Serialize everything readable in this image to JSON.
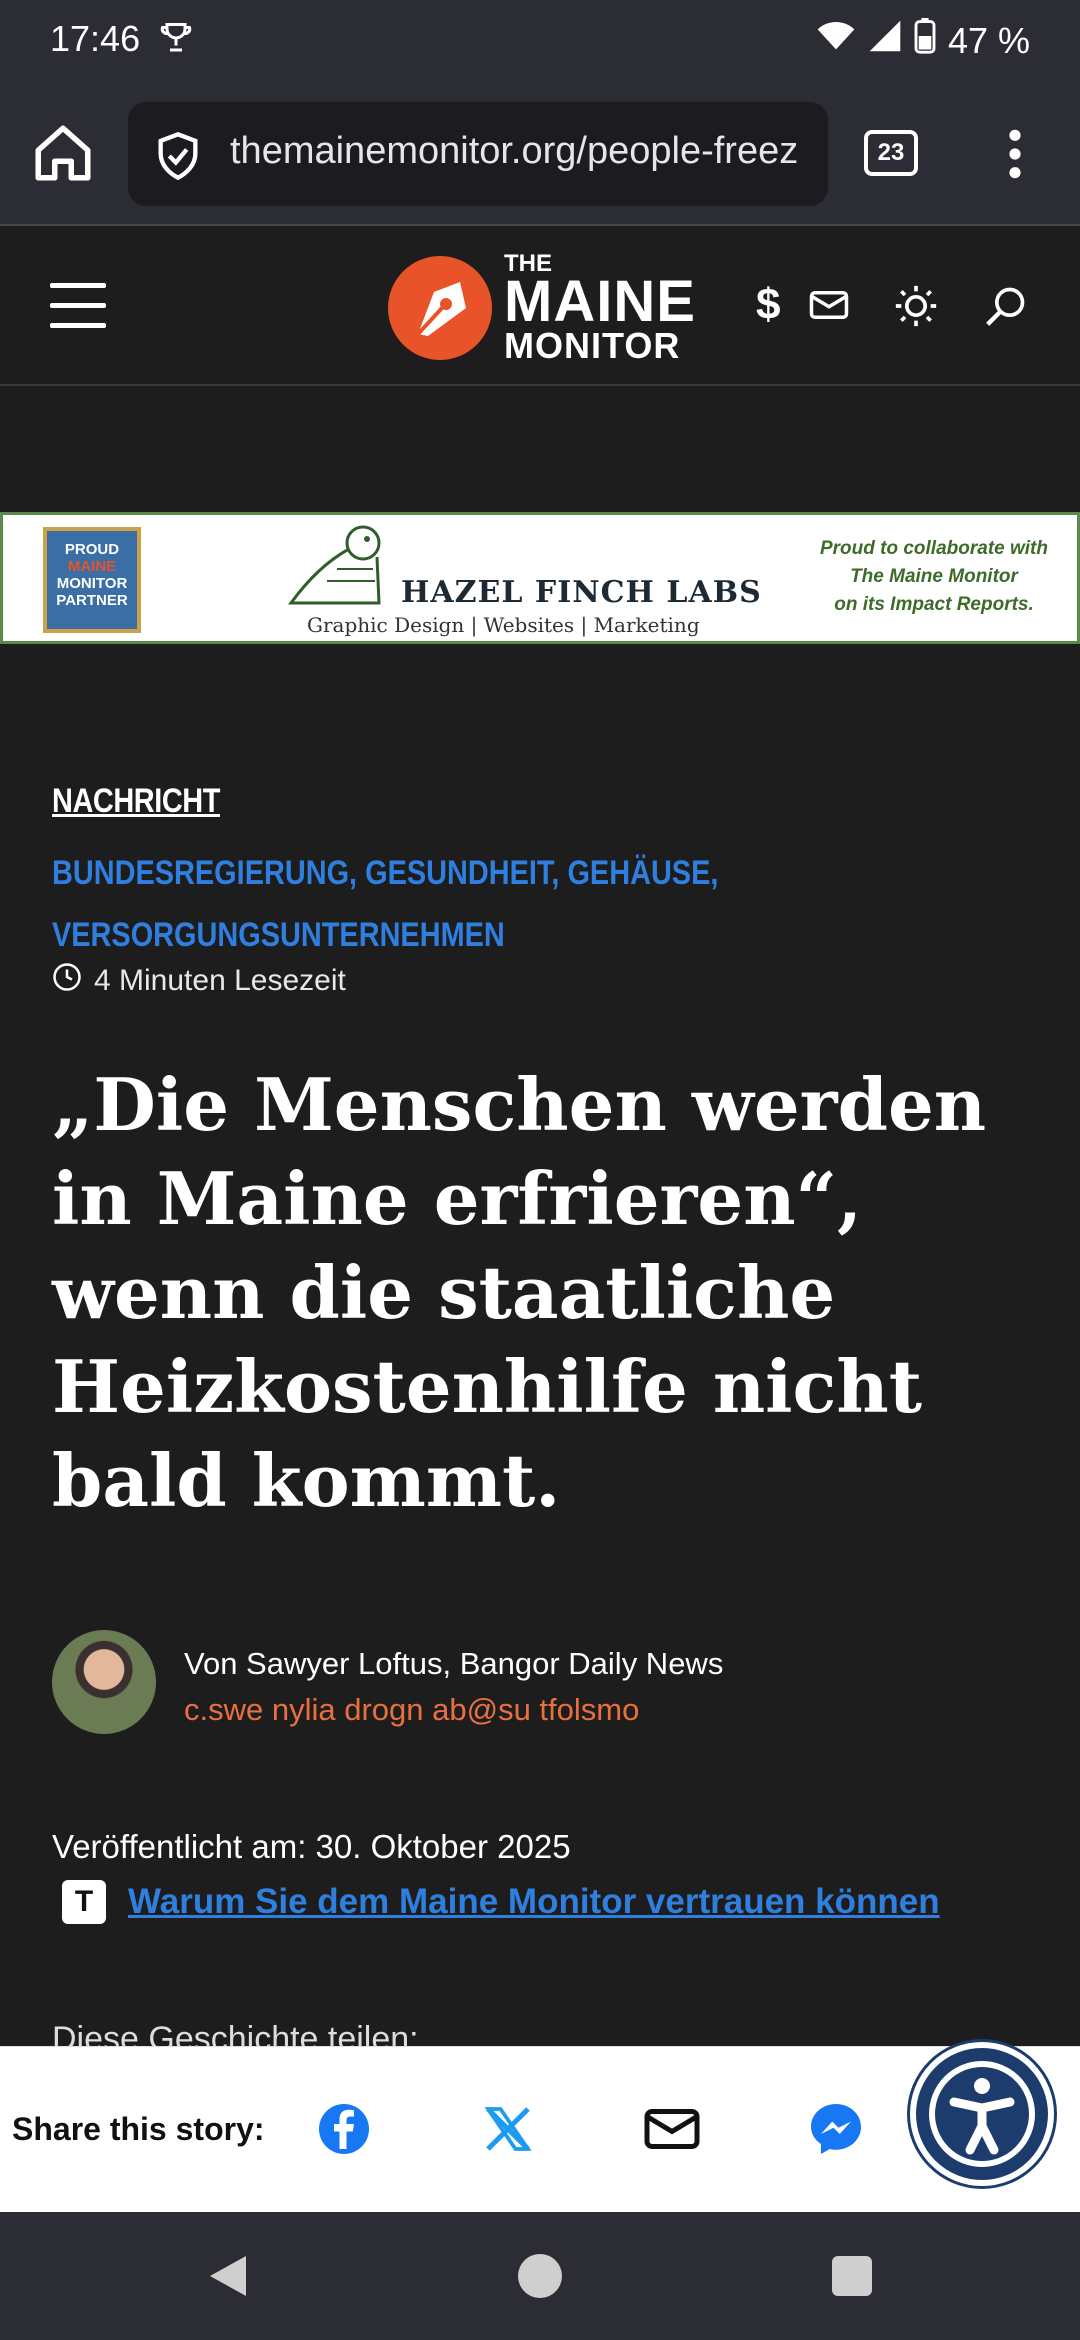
{
  "status_bar": {
    "time": "17:46",
    "battery": "47 %"
  },
  "browser": {
    "url": "themainemonitor.org/people-freez",
    "tab_count": "23"
  },
  "site": {
    "logo_the": "THE",
    "logo_maine": "MAINE",
    "logo_monitor": "MONITOR",
    "donate_symbol": "$"
  },
  "ad": {
    "badge_line1": "PROUD",
    "badge_line2": "MAINE",
    "badge_line3": "MONITOR",
    "badge_line4": "PARTNER",
    "company": "HAZEL FINCH LABS",
    "services": "Graphic Design | Websites | Marketing",
    "right_text_1": "Proud to collaborate with",
    "right_text_2": "The Maine Monitor",
    "right_text_3": "on its Impact Reports."
  },
  "article": {
    "kicker": "NACHRICHT",
    "categories_line1": "BUNDESREGIERUNG, GESUNDHEIT, GEHÄUSE,",
    "categories_line2": "VERSORGUNGSUNTERNEHMEN",
    "read_time": "4 Minuten Lesezeit",
    "headline": "„Die Menschen werden in Maine erfrieren“, wenn die staatliche Heizkostenhilfe nicht bald kommt.",
    "author_name": "Von Sawyer Loftus, Bangor Daily News",
    "author_email": "c.swe nylia drogn ab@su tfolsmo",
    "published_label": "Veröffentlicht am:",
    "published_date": "30. Oktober 2025",
    "trust_icon_letter": "T",
    "trust_link": "Warum Sie dem Maine Monitor vertrauen können",
    "share_peek": "Diese Geschichte teilen:"
  },
  "share_bar": {
    "label": "Share this story:"
  },
  "colors": {
    "accent_orange": "#e8532a",
    "link_blue": "#2f7fe0",
    "background": "#1d1d1d"
  }
}
